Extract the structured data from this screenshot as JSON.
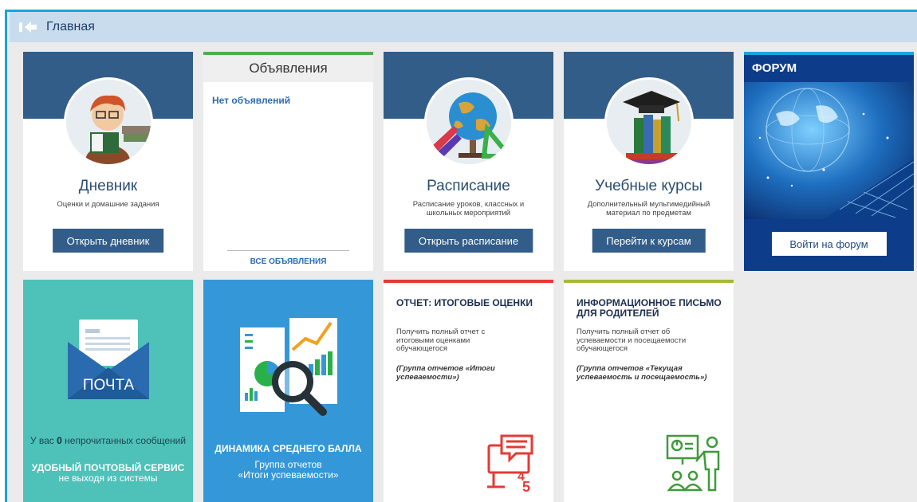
{
  "header": {
    "title": "Главная"
  },
  "diary": {
    "title": "Дневник",
    "subtitle": "Оценки и домашние задания",
    "button": "Открыть дневник"
  },
  "announcements": {
    "title": "Объявления",
    "empty": "Нет объявлений",
    "all_link": "ВСЕ ОБЪЯВЛЕНИЯ"
  },
  "schedule": {
    "title": "Расписание",
    "subtitle": "Расписание уроков, классных и школьных мероприятий",
    "button": "Открыть расписание"
  },
  "courses": {
    "title": "Учебные курсы",
    "subtitle": "Дополнительный мультимедийный материал по предметам",
    "button": "Перейти к курсам"
  },
  "forum": {
    "title": "ФОРУМ",
    "button": "Войти на форум"
  },
  "mail": {
    "label": "ПОЧТА",
    "count_prefix": "У вас",
    "count": "0",
    "count_suffix": "непрочитанных сообщений",
    "service_line1": "УДОБНЫЙ ПОЧТОВЫЙ СЕРВИС",
    "service_line2": "не выходя из системы"
  },
  "dynamics": {
    "title": "ДИНАМИКА СРЕДНЕГО БАЛЛА",
    "subtitle_line1": "Группа отчетов",
    "subtitle_line2": "«Итоги успеваемости»"
  },
  "report_grades": {
    "title": "ОТЧЕТ: ИТОГОВЫЕ ОЦЕНКИ",
    "description": "Получить полный отчет с итоговыми оценками обучающегося",
    "group": "(Группа отчетов «Итоги успеваемости»)",
    "accent": "#e53935"
  },
  "report_letter": {
    "title": "ИНФОРМАЦИОННОЕ ПИСЬМО ДЛЯ РОДИТЕЛЕЙ",
    "description": "Получить полный отчет об успеваемости и посещаемости обучающегося",
    "group": "(Группа отчетов «Текущая успеваемость и посещаемость»)",
    "accent": "#a6b83a"
  },
  "colors": {
    "frame": "#1aa3e0",
    "topbar": "#c8dcee",
    "tile_band": "#325d88",
    "mail_bg": "#4ec1b8",
    "dynamics_bg": "#3498d8",
    "forum_bg": "#0d3d8a"
  },
  "icons": [
    "back-icon",
    "student-avatar",
    "globe-avatar",
    "books-avatar",
    "forum-image",
    "mail-envelope-icon",
    "analytics-icon",
    "grade-report-icon",
    "presentation-icon"
  ]
}
